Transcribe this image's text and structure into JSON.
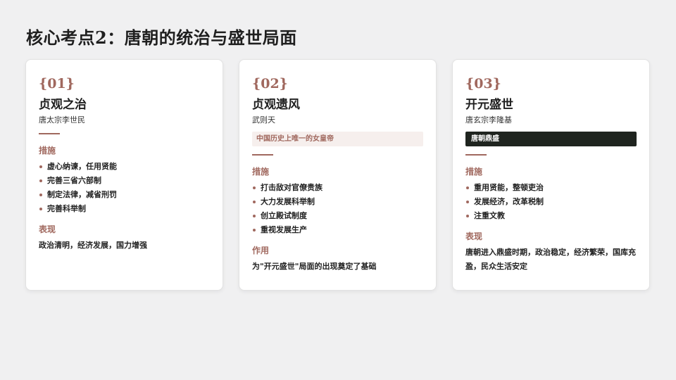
{
  "page": {
    "title": "核心考点2：唐朝的统治与盛世局面"
  },
  "cards": [
    {
      "number": "{01}",
      "name": "贞观之治",
      "ruler": "唐太宗李世民",
      "measures_label": "措施",
      "measures": [
        "虚心纳谏，任用贤能",
        "完善三省六部制",
        "制定法律，减省刑罚",
        "完善科举制"
      ],
      "result_label": "表现",
      "result": "政治清明，经济发展，国力增强"
    },
    {
      "number": "{02}",
      "name": "贞观遗风",
      "ruler": "武则天",
      "tag": "中国历史上唯一的女皇帝",
      "measures_label": "措施",
      "measures": [
        "打击敌对官僚贵族",
        "大力发展科举制",
        "创立殿试制度",
        "重视发展生产"
      ],
      "result_label": "作用",
      "result": "为\"开元盛世\"局面的出现奠定了基础"
    },
    {
      "number": "{03}",
      "name": "开元盛世",
      "ruler": "唐玄宗李隆基",
      "tag": "唐朝鼎盛",
      "measures_label": "措施",
      "measures": [
        "重用贤能，整顿吏治",
        "发展经济，改革税制",
        "注重文教"
      ],
      "result_label": "表现",
      "result": "唐朝进入鼎盛时期，政治稳定，经济繁荣，国库充盈，民众生活安定"
    }
  ],
  "colors": {
    "accent": "#a0685e",
    "dark_badge": "#1f241f",
    "light_badge": "#f6efed",
    "background": "#f0f0f1"
  }
}
